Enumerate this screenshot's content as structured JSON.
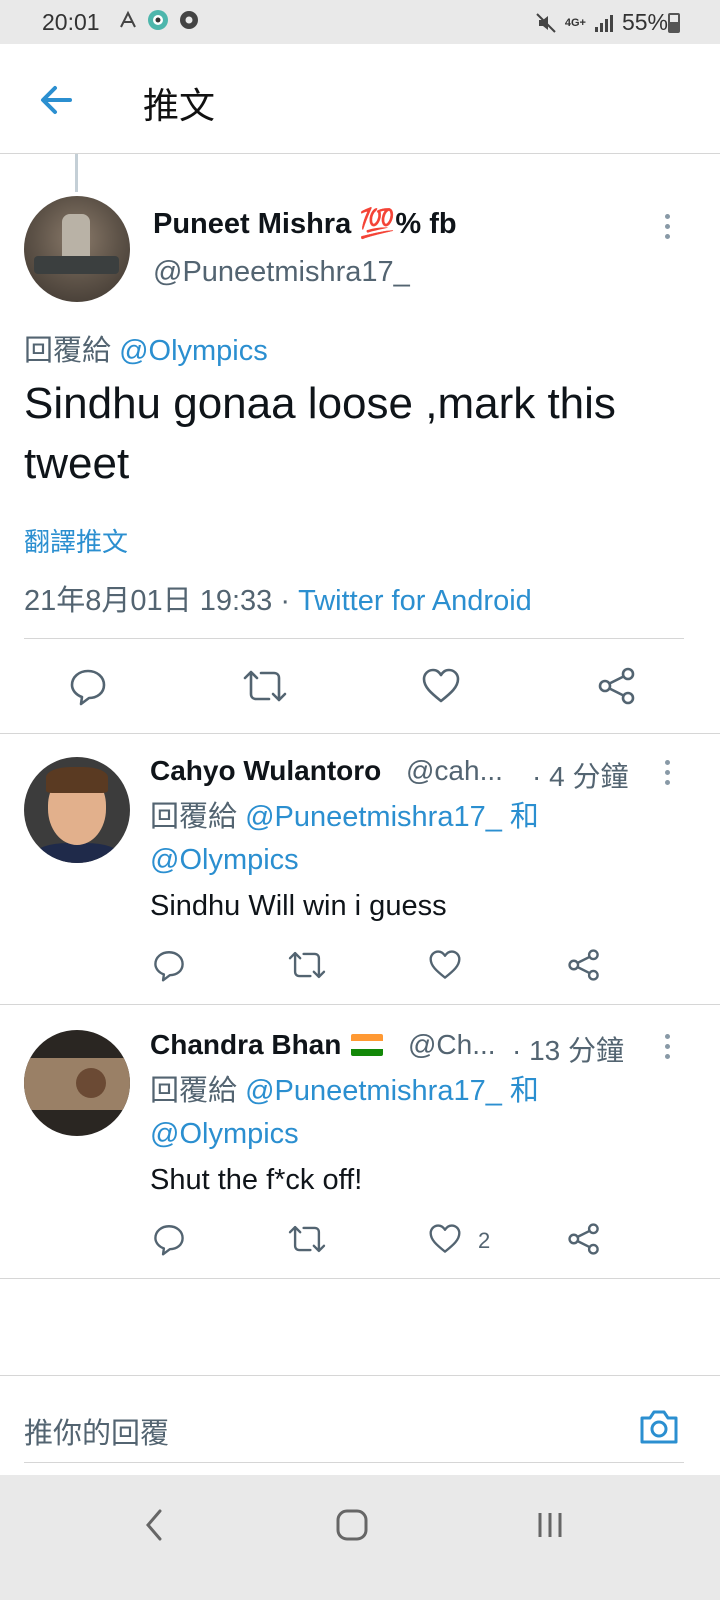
{
  "status_bar": {
    "time": "20:01",
    "battery": "55%",
    "network": "4G+"
  },
  "app_bar": {
    "title": "推文"
  },
  "main_tweet": {
    "name": "Puneet Mishra",
    "name_emoji": "💯",
    "name_suffix": "% fb",
    "handle": "@Puneetmishra17_",
    "reply_prefix": "回覆給",
    "reply_target": "@Olympics",
    "text": "Sindhu gonaa loose ,mark this tweet",
    "translate": "翻譯推文",
    "date": "21年8月01日 19:33",
    "sep": "·",
    "source": "Twitter for Android"
  },
  "replies": [
    {
      "name": "Cahyo Wulantoro",
      "handle": "@cah...",
      "time": "· 4 分鐘",
      "reply_prefix": "回覆給",
      "reply_target_1": "@Puneetmishra17_",
      "reply_and": "和",
      "reply_target_2": "@Olympics",
      "text": "Sindhu Will win i guess",
      "likes": ""
    },
    {
      "name": "Chandra Bhan",
      "handle": "@Ch...",
      "time": "· 13 分鐘",
      "reply_prefix": "回覆給",
      "reply_target_1": "@Puneetmishra17_",
      "reply_and": "和",
      "reply_target_2": "@Olympics",
      "text": "Shut the f*ck off!",
      "likes": "2"
    }
  ],
  "compose": {
    "placeholder": "推你的回覆"
  },
  "colors": {
    "accent": "#2b8fd0",
    "secondary_text": "#536471",
    "icon": "#536471"
  }
}
